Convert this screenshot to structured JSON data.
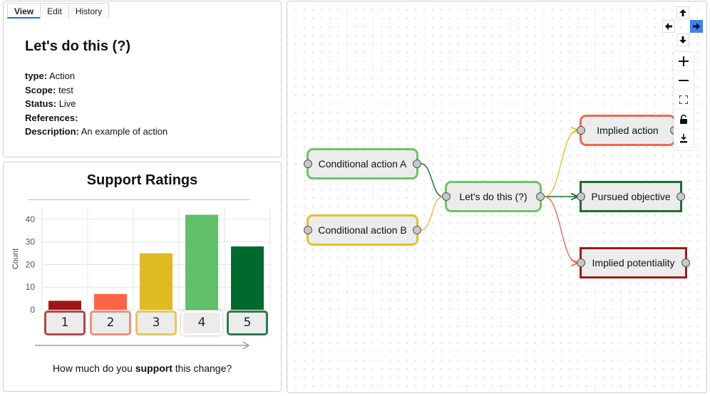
{
  "tabs": [
    "View",
    "Edit",
    "History"
  ],
  "info": {
    "title": "Let's do this (?)",
    "fields": [
      {
        "label": "type:",
        "value": "Action"
      },
      {
        "label": "Scope:",
        "value": "test"
      },
      {
        "label": "Status:",
        "value": "Live"
      },
      {
        "label": "References:",
        "value": ""
      },
      {
        "label": "Description:",
        "value": "An example of action"
      }
    ]
  },
  "ratings": {
    "title": "Support Ratings",
    "question_pre": "How much do you ",
    "question_bold": "support",
    "question_post": " this change?",
    "buttons": [
      "1",
      "2",
      "3",
      "4",
      "5"
    ]
  },
  "chart_data": {
    "type": "bar",
    "categories": [
      "1",
      "2",
      "3",
      "4",
      "5"
    ],
    "values": [
      4,
      7,
      25,
      42,
      28
    ],
    "colors": [
      "#a01616",
      "#ff6348",
      "#dfba22",
      "#62c06a",
      "#006a2e"
    ],
    "border_colors": [
      "#b24646",
      "#f0907a",
      "#e6c75a",
      "#ffffff",
      "#2e7a48"
    ],
    "ylabel": "Count",
    "yticks": [
      0,
      10,
      20,
      30,
      40
    ],
    "ylim": [
      0,
      45
    ],
    "grid": true
  },
  "graph": {
    "nodes": [
      {
        "id": "cond-a",
        "label": "Conditional action A",
        "border": "#6cc36b",
        "shape": "round"
      },
      {
        "id": "cond-b",
        "label": "Conditional action B",
        "border": "#e1c032",
        "shape": "round"
      },
      {
        "id": "main",
        "label": "Let's do this (?)",
        "border": "#6cc36b",
        "shape": "round"
      },
      {
        "id": "implied-action",
        "label": "Implied action",
        "border": "#f06a4e",
        "shape": "round"
      },
      {
        "id": "pursued",
        "label": "Pursued objective",
        "border": "#1f6b32",
        "shape": "square"
      },
      {
        "id": "potentiality",
        "label": "Implied potentiality",
        "border": "#9b1c1c",
        "shape": "square"
      }
    ],
    "edges": [
      {
        "from": "cond-a",
        "to": "main",
        "color": "#1f6b32"
      },
      {
        "from": "cond-b",
        "to": "main",
        "color": "#e1c032"
      },
      {
        "from": "main",
        "to": "implied-action",
        "color": "#e1c032"
      },
      {
        "from": "main",
        "to": "pursued",
        "color": "#1f6b32"
      },
      {
        "from": "main",
        "to": "potentiality",
        "color": "#f06a4e"
      }
    ]
  },
  "controls": {
    "pan": [
      "up-arrow-icon",
      "left-arrow-icon",
      "right-arrow-icon",
      "down-arrow-icon"
    ],
    "pan_active": "right-arrow-icon",
    "zoom": [
      "plus-icon",
      "minus-icon",
      "fit-view-icon",
      "lock-icon",
      "download-icon"
    ],
    "accent": "#3b82f6"
  }
}
